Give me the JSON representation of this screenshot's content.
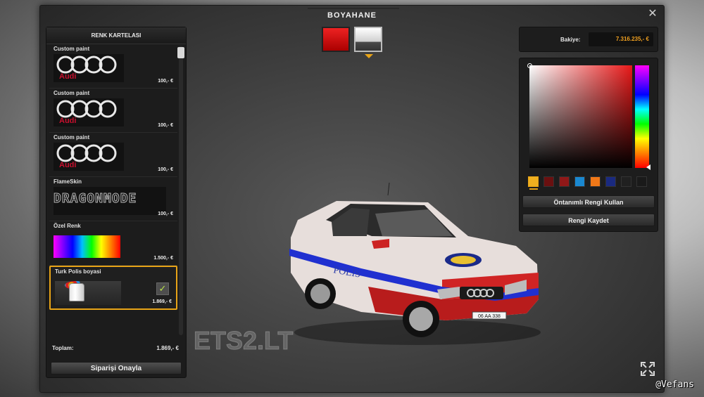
{
  "window": {
    "title": "BOYAHANE"
  },
  "left_panel": {
    "header": "RENK KARTELASI",
    "items": [
      {
        "label": "Custom paint",
        "price": "100,- €",
        "thumb": "Audi",
        "thumb_icon": "audi-logo"
      },
      {
        "label": "Custom paint",
        "price": "100,- €",
        "thumb": "Audi",
        "thumb_icon": "audi-logo"
      },
      {
        "label": "Custom paint",
        "price": "100,- €",
        "thumb": "Audi",
        "thumb_icon": "audi-logo"
      },
      {
        "label": "FlameSkin",
        "price": "100,- €",
        "thumb": "DRAGONMODE",
        "thumb_icon": "dragonmode-logo"
      },
      {
        "label": "Özel Renk",
        "price": "1.500,- €",
        "thumb_icon": "rainbow-swatch"
      },
      {
        "label": "Turk Polis boyasi",
        "price": "1.869,- €",
        "thumb_icon": "paint-can",
        "selected": true
      }
    ],
    "total_label": "Toplam:",
    "total_value": "1.869,- €",
    "confirm_label": "Siparişi Onayla"
  },
  "swatches": [
    {
      "name": "primary",
      "color": "#d81818"
    },
    {
      "name": "secondary",
      "color": "#ffffff",
      "selected": true
    }
  ],
  "balance": {
    "label": "Bakiye:",
    "value": "7.316.235,- €"
  },
  "color_picker": {
    "hue_color": "#e81818",
    "presets": [
      "#f0b020",
      "#6a1010",
      "#901818",
      "#1a88d0",
      "#f07818",
      "#1a2a80",
      "#202020",
      "#1a1a1a"
    ],
    "default_button": "Öntanımlı Rengi Kullan",
    "save_button": "Rengi Kaydet"
  },
  "car": {
    "livery_text": "POLİS",
    "plate": "06 AA 338"
  },
  "watermark": "ETS2.LT",
  "credit": "@Vefans",
  "colors": {
    "accent": "#e8a417",
    "balance_text": "#f0a020"
  }
}
